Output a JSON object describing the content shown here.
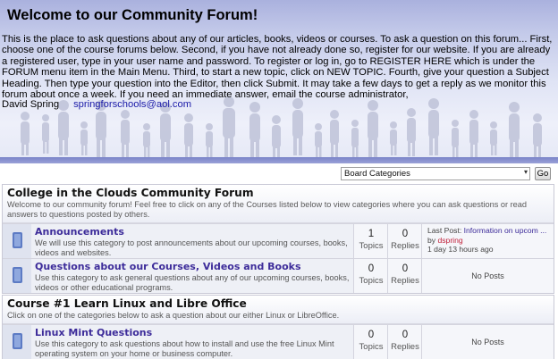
{
  "banner": {
    "title": "Welcome to our Community Forum!",
    "intro": "This is the place to ask questions about any of our articles, books, videos or courses. To ask a question on this forum... First, choose one of the course forums below. Second, if you have not already done so, register for our website. If you are already a registered user, type in your user name and password. To register or log in, go to REGISTER HERE which is under the FORUM menu item in the Main Menu. Third, to start a new topic, click on NEW TOPIC. Fourth, give your question a Subject Heading. Then type your question into the Editor, then click Submit. It may take a few days to get a reply as we monitor this forum about once a week. If you need an immediate answer, email the course administrator,",
    "signature_name": "David Spring",
    "signature_email": "springforschools@aol.com"
  },
  "nav": {
    "category_select": "Board Categories",
    "go_label": "Go"
  },
  "sections": [
    {
      "title": "College in the Clouds Community Forum",
      "description": "Welcome to our community forum! Feel free to click on any of the Courses listed below to view categories where you can ask questions or read answers to questions posted by others.",
      "forums": [
        {
          "name": "Announcements",
          "description": "We will use this category to post announcements about our upcoming courses, books, videos and websites.",
          "topics": "1",
          "topics_label": "Topics",
          "replies": "0",
          "replies_label": "Replies",
          "last_post_prefix": "Last Post:",
          "last_post_title": "Information on upcom ...",
          "last_post_by": "by",
          "last_post_user": "dspring",
          "last_post_time": "1 day 13 hours ago"
        },
        {
          "name": "Questions about our Courses, Videos and Books",
          "description": "Use this category to ask general questions about any of our upcoming courses, books, videos or other educational programs.",
          "topics": "0",
          "topics_label": "Topics",
          "replies": "0",
          "replies_label": "Replies",
          "no_posts": "No Posts"
        }
      ]
    },
    {
      "title": "Course #1 Learn Linux and Libre Office",
      "description": "Click on one of the categories below to ask a question about our either Linux or LibreOffice.",
      "forums": [
        {
          "name": "Linux Mint Questions",
          "description": "Use this category to ask questions about how to install and use the free Linux Mint operating system on your home or business computer.",
          "topics": "0",
          "topics_label": "Topics",
          "replies": "0",
          "replies_label": "Replies",
          "no_posts": "No Posts"
        }
      ]
    }
  ],
  "colors": {
    "banner_top": "#aab1de",
    "accent_bar": "#7a83c8",
    "forum_link": "#3d2c9a",
    "username": "#c0203a"
  }
}
